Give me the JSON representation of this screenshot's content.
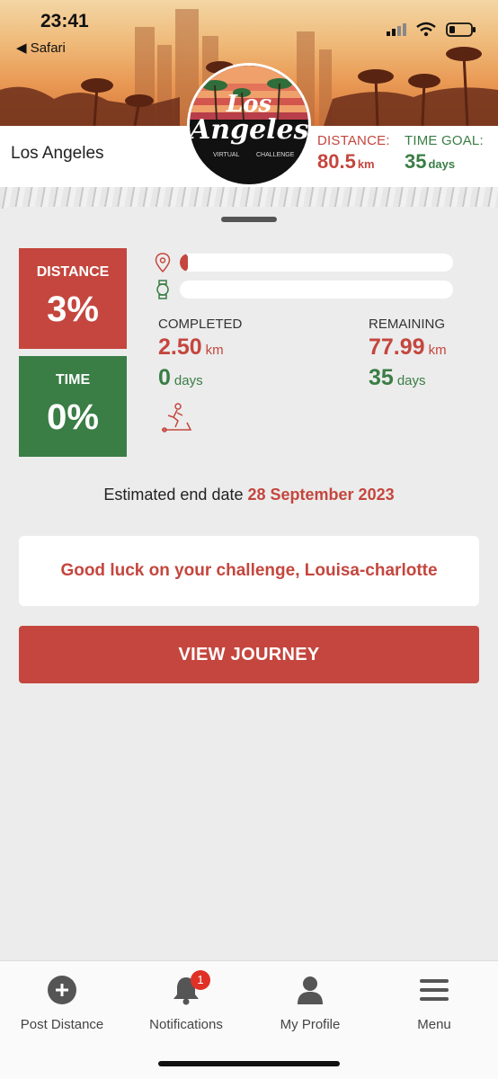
{
  "status": {
    "time": "23:41",
    "back": "◀ Safari"
  },
  "header": {
    "city": "Los Angeles",
    "distance_label": "DISTANCE:",
    "distance_value": "80.5",
    "distance_unit": "km",
    "time_label": "TIME GOAL:",
    "time_value": "35",
    "time_unit": "days"
  },
  "logo": {
    "line1": "Los",
    "line2": "Angeles",
    "sub1": "VIRTUAL",
    "sub2": "CHALLENGE"
  },
  "progress": {
    "distance_label": "DISTANCE",
    "distance_pct": "3%",
    "distance_fraction": 0.03,
    "time_label": "TIME",
    "time_pct": "0%",
    "time_fraction": 0.0
  },
  "completed": {
    "label": "COMPLETED",
    "distance": "2.50",
    "distance_unit": "km",
    "days": "0",
    "days_unit": "days"
  },
  "remaining": {
    "label": "REMAINING",
    "distance": "77.99",
    "distance_unit": "km",
    "days": "35",
    "days_unit": "days"
  },
  "estimate": {
    "prefix": "Estimated end date",
    "date": "28 September 2023"
  },
  "message": "Good luck on your challenge, Louisa-charlotte",
  "button": {
    "label": "VIEW JOURNEY"
  },
  "tabs": [
    {
      "label": "Post Distance",
      "icon": "plus-circle-icon"
    },
    {
      "label": "Notifications",
      "icon": "bell-icon",
      "badge": "1"
    },
    {
      "label": "My Profile",
      "icon": "person-icon"
    },
    {
      "label": "Menu",
      "icon": "hamburger-icon"
    }
  ],
  "colors": {
    "accent_red": "#c4463e",
    "accent_green": "#3a7d45"
  }
}
